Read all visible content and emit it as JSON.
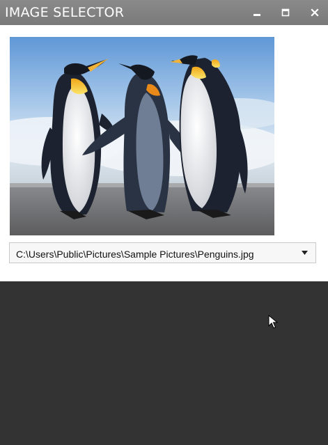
{
  "window": {
    "title": "IMAGE SELECTOR",
    "controls": {
      "minimize_icon": "minimize-icon",
      "maximize_icon": "maximize-icon",
      "close_icon": "close-icon"
    }
  },
  "image": {
    "subject": "Penguins"
  },
  "selector": {
    "selected_value": "C:\\Users\\Public\\Pictures\\Sample Pictures\\Penguins.jpg",
    "arrow_icon": "dropdown-arrow-icon"
  },
  "colors": {
    "titlebar": "#7f7f7f",
    "window_bg": "#ffffff",
    "desktop_bg": "#333333"
  }
}
